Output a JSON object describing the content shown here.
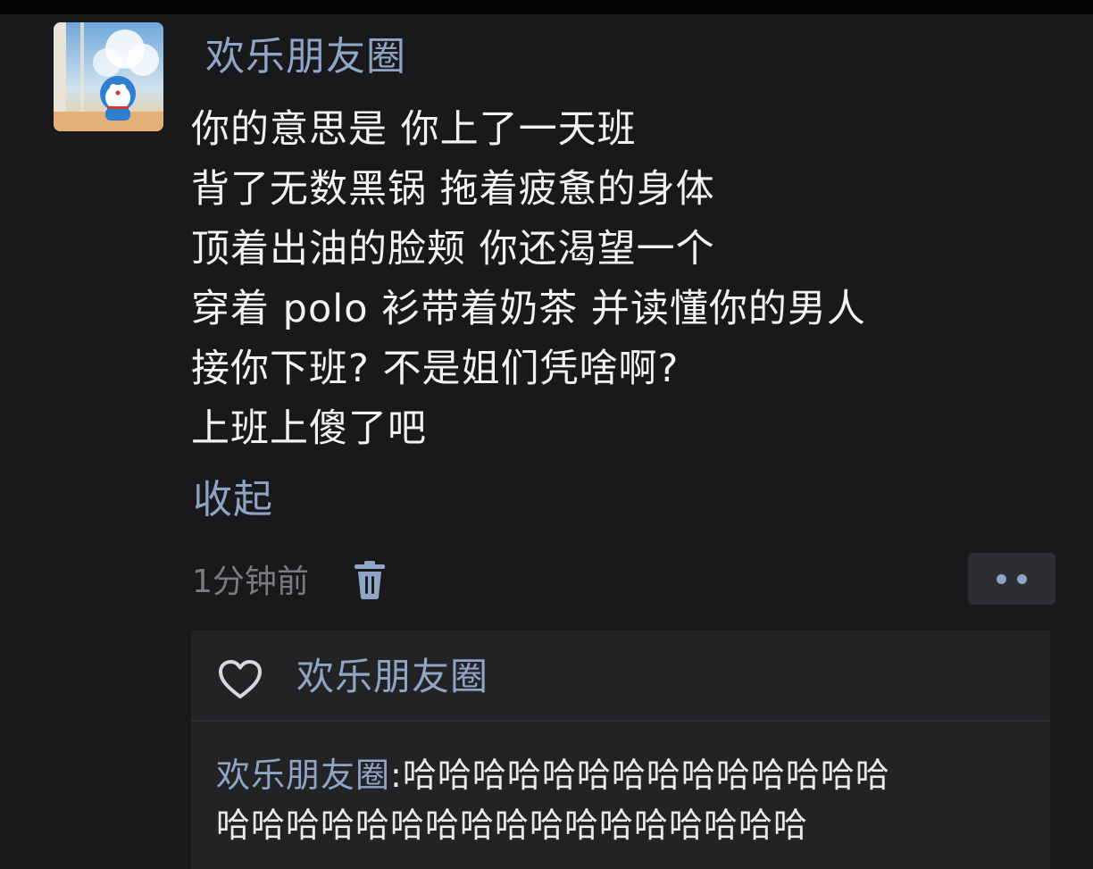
{
  "post": {
    "author": "欢乐朋友圈",
    "lines": [
      "你的意思是 你上了一天班",
      "背了无数黑锅 拖着疲惫的身体",
      "顶着出油的脸颊 你还渴望一个",
      "穿着 polo 衫带着奶茶 并读懂你的男人",
      "接你下班? 不是姐们凭啥啊?",
      "上班上傻了吧"
    ],
    "collapse_label": "收起",
    "time": "1分钟前",
    "icons": {
      "delete": "trash-icon",
      "more": "more-dots-icon"
    }
  },
  "likes": {
    "icon": "heart-icon",
    "names": "欢乐朋友圈"
  },
  "comment": {
    "author": "欢乐朋友圈",
    "separator": ":",
    "text_line1": "哈哈哈哈哈哈哈哈哈哈哈哈哈哈",
    "text_line2": "哈哈哈哈哈哈哈哈哈哈哈哈哈哈哈哈哈"
  },
  "colors": {
    "background": "#19191b",
    "link_blue": "#8ea5c6",
    "text": "#f2f2f2",
    "muted": "#7b7b7f"
  }
}
